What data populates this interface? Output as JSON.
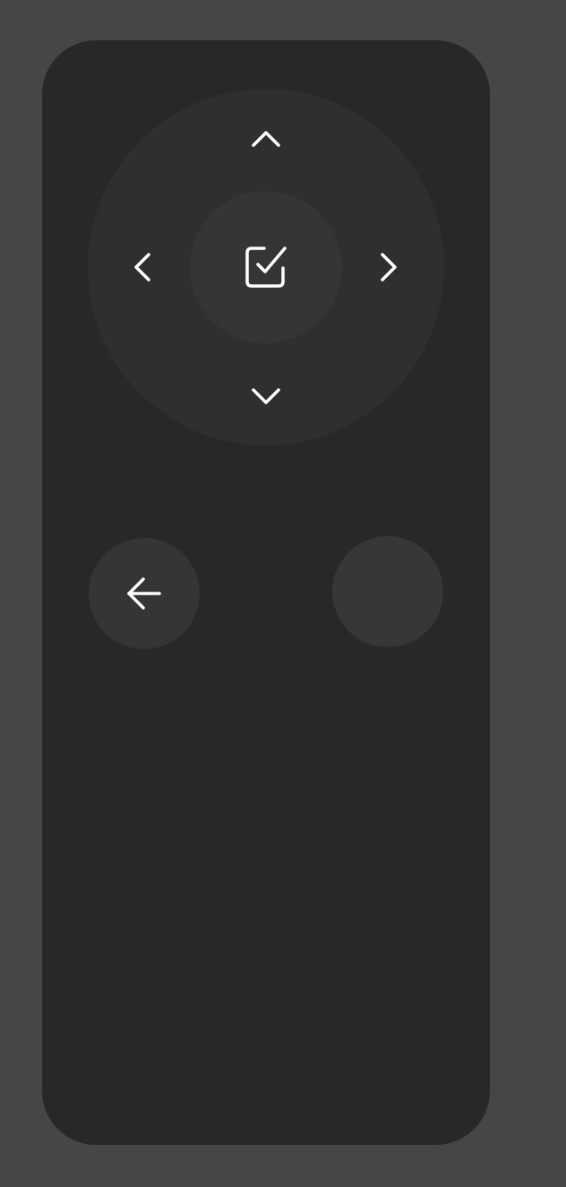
{
  "remote": {
    "dpad": {
      "up_icon": "chevron-up-icon",
      "down_icon": "chevron-down-icon",
      "left_icon": "chevron-left-icon",
      "right_icon": "chevron-right-icon",
      "select_icon": "checkbox-check-icon"
    },
    "buttons": [
      {
        "icon": "arrow-left-icon"
      },
      {
        "icon": ""
      }
    ]
  },
  "colors": {
    "background": "#464646",
    "remote_body": "#28282a",
    "dpad_ring": "#2f2f2f",
    "button": "#353535",
    "icon": "#ffffff"
  }
}
